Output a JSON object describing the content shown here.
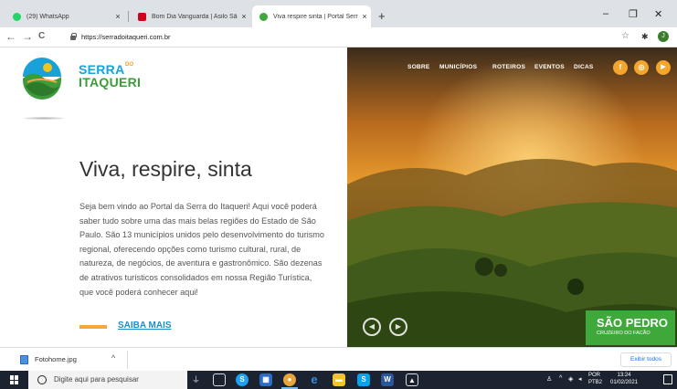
{
  "browser": {
    "tabs": [
      {
        "title": "(29) WhatsApp",
        "favicon_color": "#25d366",
        "active": false
      },
      {
        "title": "Bom Dia Vanguarda | Asilo São V",
        "favicon_color": "#d0021b",
        "active": false
      },
      {
        "title": "Viva respire sinta | Portal Serra do",
        "favicon_color": "#3ea83a",
        "active": true
      }
    ],
    "tab_close_glyph": "×",
    "new_tab_glyph": "+",
    "window_controls": {
      "minimize": "–",
      "restore": "❐",
      "close": "✕"
    },
    "url": "https://serradoitaqueri.com.br",
    "nav": {
      "back": "←",
      "forward": "→",
      "reload": "C"
    },
    "profile_initial": "J"
  },
  "site": {
    "logo_text_line1": "SERRA",
    "logo_text_do": "DO",
    "logo_text_line2": "ITAQUERI",
    "headline": "Viva, respire, sinta",
    "intro": "Seja bem vindo ao Portal da Serra do Itaqueri! Aqui você poderá saber tudo sobre uma das mais belas regiões do Estado de São Paulo. São 13 municípios unidos pelo desenvolvimento do turismo regional, oferecendo opções como turismo cultural, rural, de natureza, de negócios, de aventura e gastronômico. São dezenas de atrativos turísticos consolidados em nossa Região Turística, que você poderá conhecer aqui!",
    "cta": "SAIBA MAIS",
    "menu": [
      "SOBRE",
      "MUNICÍPIOS",
      "ROTEIROS",
      "EVENTOS",
      "DICAS"
    ],
    "social": [
      {
        "name": "facebook-icon",
        "glyph": "f"
      },
      {
        "name": "instagram-icon",
        "glyph": "◎"
      },
      {
        "name": "youtube-icon",
        "glyph": "▶"
      }
    ],
    "slider": {
      "prev": "◀",
      "next": "▶",
      "title": "SÃO PEDRO",
      "subtitle": "CRUZEIRO DO FACÃO"
    },
    "colors": {
      "blue": "#19a1d9",
      "green": "#3ea83a",
      "orange": "#f4a83b"
    }
  },
  "downloads": {
    "file": "Fotohome.jpg",
    "chevron": "^",
    "show_all": "Exibir todos"
  },
  "taskbar": {
    "search_placeholder": "Digite aqui para pesquisar",
    "language": "POR",
    "language_sub": "PTB2",
    "time": "13:24",
    "date": "01/02/2021"
  }
}
